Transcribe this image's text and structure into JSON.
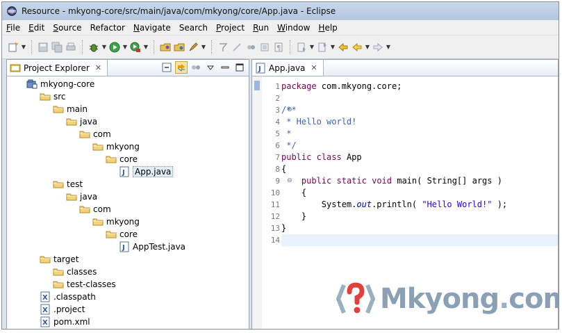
{
  "window": {
    "title": "Resource - mkyong-core/src/main/java/com/mkyong/core/App.java - Eclipse"
  },
  "menu": [
    {
      "label": "File",
      "mnemonic": "F",
      "rest": "ile"
    },
    {
      "label": "Edit",
      "mnemonic": "E",
      "rest": "dit"
    },
    {
      "label": "Source",
      "mnemonic": "S",
      "rest": "ource"
    },
    {
      "label": "Refactor",
      "mnemonic": "",
      "rest": "Refactor"
    },
    {
      "label": "Navigate",
      "mnemonic": "N",
      "rest": "avigate"
    },
    {
      "label": "Search",
      "mnemonic": "",
      "rest": "Search"
    },
    {
      "label": "Project",
      "mnemonic": "P",
      "rest": "roject"
    },
    {
      "label": "Run",
      "mnemonic": "R",
      "rest": "un"
    },
    {
      "label": "Window",
      "mnemonic": "W",
      "rest": "indow"
    },
    {
      "label": "Help",
      "mnemonic": "H",
      "rest": "elp"
    }
  ],
  "toolbar_icons": [
    "new-icon",
    "save-icon",
    "save-all-icon",
    "print-icon",
    "debug-icon",
    "run-icon",
    "external-tools-icon",
    "open-project-icon",
    "open-folder-icon",
    "rocket-icon",
    "toggle-icon",
    "mark-icon",
    "annotate-icon",
    "block-icon",
    "pilcrow-icon",
    "next-annotation-icon",
    "prev-annotation-icon",
    "last-edit-icon",
    "back-icon",
    "forward-icon"
  ],
  "explorer": {
    "tab_label": "Project Explorer",
    "tree": [
      {
        "label": "mkyong-core",
        "depth": 0,
        "kind": "project"
      },
      {
        "label": "src",
        "depth": 1,
        "kind": "folder"
      },
      {
        "label": "main",
        "depth": 2,
        "kind": "folder"
      },
      {
        "label": "java",
        "depth": 3,
        "kind": "folder"
      },
      {
        "label": "com",
        "depth": 4,
        "kind": "folder"
      },
      {
        "label": "mkyong",
        "depth": 5,
        "kind": "folder"
      },
      {
        "label": "core",
        "depth": 6,
        "kind": "folder"
      },
      {
        "label": "App.java",
        "depth": 7,
        "kind": "java",
        "selected": true
      },
      {
        "label": "test",
        "depth": 2,
        "kind": "folder"
      },
      {
        "label": "java",
        "depth": 3,
        "kind": "folder"
      },
      {
        "label": "com",
        "depth": 4,
        "kind": "folder"
      },
      {
        "label": "mkyong",
        "depth": 5,
        "kind": "folder"
      },
      {
        "label": "core",
        "depth": 6,
        "kind": "folder"
      },
      {
        "label": "AppTest.java",
        "depth": 7,
        "kind": "java"
      },
      {
        "label": "target",
        "depth": 1,
        "kind": "folder"
      },
      {
        "label": "classes",
        "depth": 2,
        "kind": "folder"
      },
      {
        "label": "test-classes",
        "depth": 2,
        "kind": "folder"
      },
      {
        "label": ".classpath",
        "depth": 1,
        "kind": "xml"
      },
      {
        "label": ".project",
        "depth": 1,
        "kind": "xml"
      },
      {
        "label": "pom.xml",
        "depth": 1,
        "kind": "xml"
      }
    ]
  },
  "editor": {
    "tab_label": "App.java",
    "lines": [
      {
        "n": "1",
        "fold": "",
        "segments": [
          {
            "t": "package",
            "c": "kw"
          },
          {
            "t": " com.mkyong.core;",
            "c": ""
          }
        ]
      },
      {
        "n": "2",
        "fold": "",
        "segments": []
      },
      {
        "n": "3",
        "fold": "⊖",
        "segments": [
          {
            "t": "/**",
            "c": "cm"
          }
        ]
      },
      {
        "n": "4",
        "fold": "",
        "segments": [
          {
            "t": " * Hello world!",
            "c": "cm"
          }
        ]
      },
      {
        "n": "5",
        "fold": "",
        "segments": [
          {
            "t": " *",
            "c": "cm"
          }
        ]
      },
      {
        "n": "6",
        "fold": "",
        "segments": [
          {
            "t": " */",
            "c": "cm"
          }
        ]
      },
      {
        "n": "7",
        "fold": "",
        "segments": [
          {
            "t": "public",
            "c": "kw"
          },
          {
            "t": " ",
            "c": ""
          },
          {
            "t": "class",
            "c": "kw"
          },
          {
            "t": " App",
            "c": ""
          }
        ]
      },
      {
        "n": "8",
        "fold": "",
        "segments": [
          {
            "t": "{",
            "c": ""
          }
        ]
      },
      {
        "n": "9",
        "fold": "⊖",
        "segments": [
          {
            "t": "    ",
            "c": ""
          },
          {
            "t": "public",
            "c": "kw"
          },
          {
            "t": " ",
            "c": ""
          },
          {
            "t": "static",
            "c": "kw"
          },
          {
            "t": " ",
            "c": ""
          },
          {
            "t": "void",
            "c": "kw"
          },
          {
            "t": " main( String[] args )",
            "c": ""
          }
        ]
      },
      {
        "n": "10",
        "fold": "",
        "segments": [
          {
            "t": "    {",
            "c": ""
          }
        ]
      },
      {
        "n": "11",
        "fold": "",
        "segments": [
          {
            "t": "        System.",
            "c": ""
          },
          {
            "t": "out",
            "c": "fld"
          },
          {
            "t": ".println( ",
            "c": ""
          },
          {
            "t": "\"Hello World!\"",
            "c": "st"
          },
          {
            "t": " );",
            "c": ""
          }
        ]
      },
      {
        "n": "12",
        "fold": "",
        "segments": [
          {
            "t": "    }",
            "c": ""
          }
        ]
      },
      {
        "n": "13",
        "fold": "",
        "segments": [
          {
            "t": "}",
            "c": ""
          }
        ]
      },
      {
        "n": "14",
        "fold": "",
        "segments": [],
        "current": true
      }
    ]
  },
  "watermark": {
    "prefix": "Mkyong",
    "dot": ".",
    "suffix": "com"
  },
  "colors": {
    "keyword": "#7f0055",
    "comment": "#3f5fbf",
    "string": "#2a00ff",
    "field": "#0000c0"
  }
}
